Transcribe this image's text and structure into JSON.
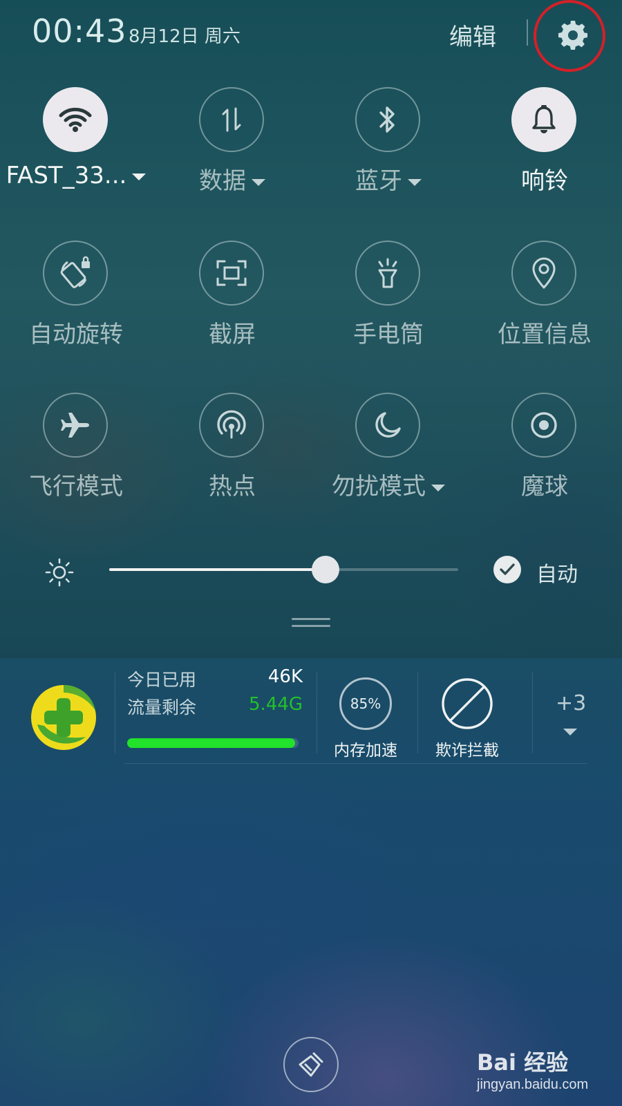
{
  "status_bar": {
    "time": "00:43",
    "date": "8月12日 周六",
    "edit_label": "编辑",
    "settings_icon": "gear-icon",
    "highlight_color": "#d42027"
  },
  "quick_tiles": [
    {
      "label": "FAST_33...",
      "icon": "wifi-icon",
      "active": true,
      "has_dropdown": true
    },
    {
      "label": "数据",
      "icon": "mobile-data-icon",
      "active": false,
      "has_dropdown": true
    },
    {
      "label": "蓝牙",
      "icon": "bluetooth-icon",
      "active": false,
      "has_dropdown": true
    },
    {
      "label": "响铃",
      "icon": "bell-icon",
      "active": true,
      "has_dropdown": false
    },
    {
      "label": "自动旋转",
      "icon": "auto-rotate-icon",
      "active": false,
      "has_dropdown": false
    },
    {
      "label": "截屏",
      "icon": "screenshot-icon",
      "active": false,
      "has_dropdown": false
    },
    {
      "label": "手电筒",
      "icon": "flashlight-icon",
      "active": false,
      "has_dropdown": false
    },
    {
      "label": "位置信息",
      "icon": "location-icon",
      "active": false,
      "has_dropdown": false
    },
    {
      "label": "飞行模式",
      "icon": "airplane-icon",
      "active": false,
      "has_dropdown": false
    },
    {
      "label": "热点",
      "icon": "hotspot-icon",
      "active": false,
      "has_dropdown": false
    },
    {
      "label": "勿扰模式",
      "icon": "moon-icon",
      "active": false,
      "has_dropdown": true
    },
    {
      "label": "魔球",
      "icon": "magic-ball-icon",
      "active": false,
      "has_dropdown": false
    }
  ],
  "brightness": {
    "icon": "sun-icon",
    "level": 0.62,
    "auto_checked": true,
    "auto_label": "自动"
  },
  "notification_360": {
    "app_icon": "360-security-logo",
    "used_today_label": "今日已用",
    "used_today_value": "46K",
    "remaining_label": "流量剩余",
    "remaining_value": "5.44G",
    "remaining_color": "#22c12a",
    "remaining_fraction": 0.98,
    "memory_percent": "85%",
    "memory_label": "内存加速",
    "fraud_label": "欺诈拦截",
    "more_count": "+3"
  },
  "bottom": {
    "clear_icon": "broom-icon",
    "watermark_main": "Bai 经验",
    "watermark_sub": "jingyan.baidu.com"
  }
}
